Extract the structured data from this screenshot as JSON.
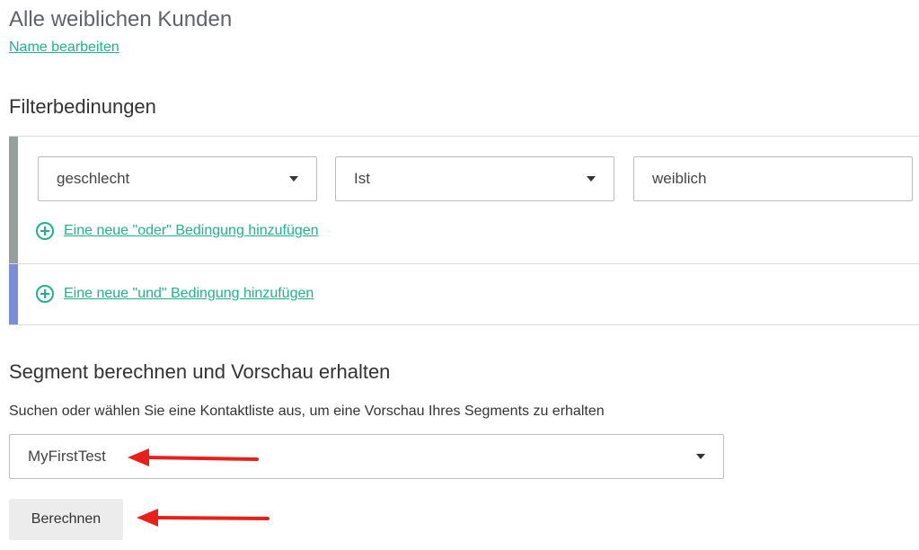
{
  "segment": {
    "title": "Alle weiblichen Kunden",
    "edit_link": "Name bearbeiten"
  },
  "filters": {
    "heading": "Filterbedinungen",
    "condition": {
      "field_value": "geschlecht",
      "operator_value": "Ist",
      "value": "weiblich"
    },
    "add_or_label": "Eine neue \"oder\" Bedingung hinzufügen",
    "add_and_label": "Eine neue \"und\" Bedingung hinzufügen",
    "colors": {
      "or_bar": "#95a09c",
      "and_bar": "#7b8fd8",
      "accent": "#1fb38a"
    }
  },
  "preview": {
    "heading": "Segment berechnen und Vorschau erhalten",
    "description": "Suchen oder wählen Sie eine Kontaktliste aus, um eine Vorschau Ihres Segments zu erhalten",
    "selected_list": "MyFirstTest",
    "calculate_label": "Berechnen"
  },
  "annotations": {
    "arrow_color": "#e8201c"
  }
}
